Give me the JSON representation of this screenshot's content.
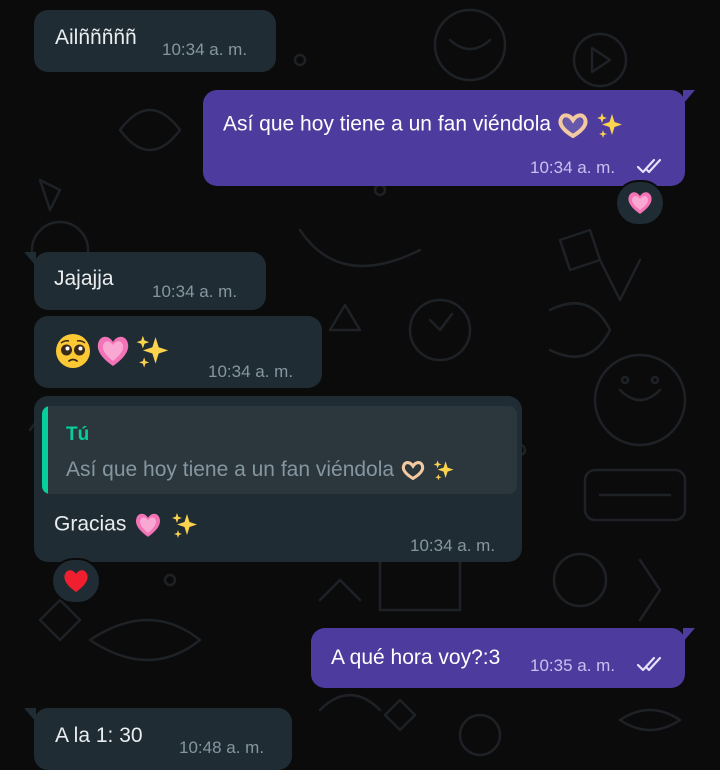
{
  "messages": [
    {
      "text": "Ailñññññ",
      "time": "10:34 a. m."
    },
    {
      "text": "Así que hoy tiene a un fan viéndola",
      "time": "10:34 a. m."
    },
    {
      "text": "Jajajja",
      "time": "10:34 a. m."
    },
    {
      "time": "10:34 a. m."
    },
    {
      "quote_author": "Tú",
      "quote_text": "Así que hoy tiene a un fan viéndola",
      "text": "Gracias",
      "time": "10:34 a. m."
    },
    {
      "text": "A qué hora voy?:3",
      "time": "10:35 a. m."
    },
    {
      "text": "A la 1: 30",
      "time": "10:48 a. m."
    }
  ],
  "reactions": [
    "pink-heart-emoji",
    "red-heart-emoji"
  ],
  "colors": {
    "background": "#0b0b0b",
    "incoming_bubble": "#1f2c34",
    "outgoing_bubble": "#4e3b9e",
    "quote_accent": "#06cf9c",
    "timestamp": "#8696a0"
  }
}
